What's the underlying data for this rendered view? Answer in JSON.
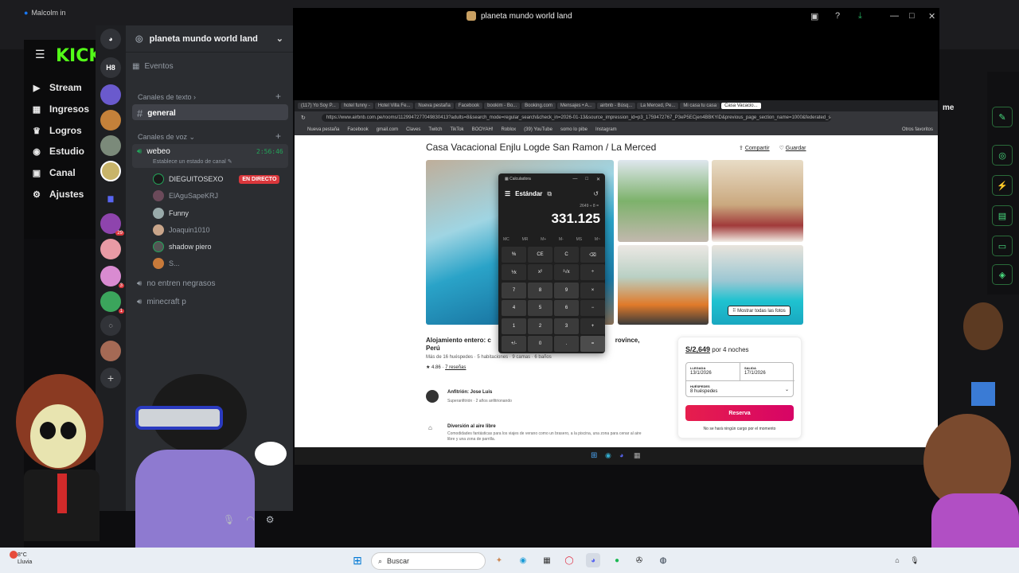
{
  "browser": {
    "tab_title": "Malcolm in",
    "kick_logo": "KICK",
    "nav": [
      {
        "icon": "stream-icon",
        "label": "Stream"
      },
      {
        "icon": "revenue-icon",
        "label": "Ingresos"
      },
      {
        "icon": "trophy-icon",
        "label": "Logros"
      },
      {
        "icon": "studio-icon",
        "label": "Estudio"
      },
      {
        "icon": "channel-icon",
        "label": "Canal"
      },
      {
        "icon": "settings-icon",
        "label": "Ajustes"
      }
    ],
    "right_text": "me"
  },
  "discord": {
    "window_title": "planeta mundo world land",
    "server_name": "planeta mundo world land",
    "server_badge_text": "H8",
    "server_badges": [
      "29",
      "3",
      "1"
    ],
    "events_label": "Eventos",
    "text_category": "Canales de texto",
    "text_channel": "general",
    "voice_category": "Canales de voz",
    "voice_channel": "webeo",
    "voice_timer": "2:56:46",
    "voice_status": "Establece un estado de canal",
    "live_badge": "EN DIRECTO",
    "voice_users": [
      "DIEGUITOSEXO",
      "ElAguSapeKRJ",
      "Funny",
      "Joaquin1010",
      "shadow piero",
      "S..."
    ],
    "other_voice": [
      "no entren negrasos",
      "minecraft p"
    ]
  },
  "shared_screen": {
    "tabs": [
      "(117) Yo Soy P...",
      "hotel funny -",
      "Hotel Villa Fe...",
      "Nueva pestaña",
      "Facebook",
      "bookim - Bo...",
      "Booking.com",
      "Mensajes • A...",
      "airbnb - Búsq...",
      "La Merced, Pe...",
      "Mi casa tu casa",
      "Casa Vacacio..."
    ],
    "url": "https://www.airbnb.com.pe/rooms/1129947277049830413?adults=8&search_mode=regular_search&check_in=2026-01-13&source_impression_id=p3_1759472767_P3eP5ECjen4BBKYiD&previous_page_section_name=1000&federated_search_...",
    "bookmarks": [
      "Nueva pestaña",
      "Facebook",
      "gmail.com",
      "Claves",
      "Twitch",
      "TikTok",
      "BOOYAH!",
      "Roblox",
      "(39) YouTube",
      "somo lo pibe",
      "Instagram",
      "Otros favoritos"
    ],
    "listing_title": "Casa Vacacional Enjlu Logde San Ramon / La Merced",
    "share_label": "Compartir",
    "save_label": "Guardar",
    "show_photos": "Mostrar todas las fotos",
    "subtitle_prefix": "Alojamiento entero: c",
    "subtitle_suffix": "rovince,",
    "subtitle_line2": "Perú",
    "guests_line": "Más de 16 huéspedes · 5 habitaciones · 9 camas · 6 baños",
    "rating": "4.86",
    "reviews": "7 reseñas",
    "host": "Anfitrión: Jose Luis",
    "host_sub": "Superanfitrión · 2 años anfitrionando",
    "feature_title": "Diversión al aire libre",
    "feature_desc": "Comodidades fantásticas para los viajes de verano como un brasero, a la piscina, una zona para cenar al aire libre y una zona de parrilla.",
    "price": "S/2,649",
    "price_suffix": "por 4 noches",
    "checkin_label": "LLEGADA",
    "checkin": "13/1/2026",
    "checkout_label": "SALIDA",
    "checkout": "17/1/2026",
    "guests_label": "HUÉSPEDES",
    "guests_value": "8 huéspedes",
    "reserve_label": "Reserva",
    "no_charge": "No se hará ningún cargo por el momento"
  },
  "calculator": {
    "app_name": "Calculadora",
    "mode": "Estándar",
    "expression": "2649 ÷ 8 =",
    "display": "331.125",
    "memory": [
      "MC",
      "MR",
      "M+",
      "M-",
      "MS",
      "M~"
    ],
    "keys": [
      [
        "%",
        "CE",
        "C",
        "⌫"
      ],
      [
        "⅟x",
        "x²",
        "²√x",
        "÷"
      ],
      [
        "7",
        "8",
        "9",
        "×"
      ],
      [
        "4",
        "5",
        "6",
        "−"
      ],
      [
        "1",
        "2",
        "3",
        "+"
      ],
      [
        "+/-",
        "0",
        ".",
        "="
      ]
    ]
  },
  "taskbar": {
    "weather_temp": "8°C",
    "weather_desc": "Lluvia",
    "search_placeholder": "Buscar"
  }
}
